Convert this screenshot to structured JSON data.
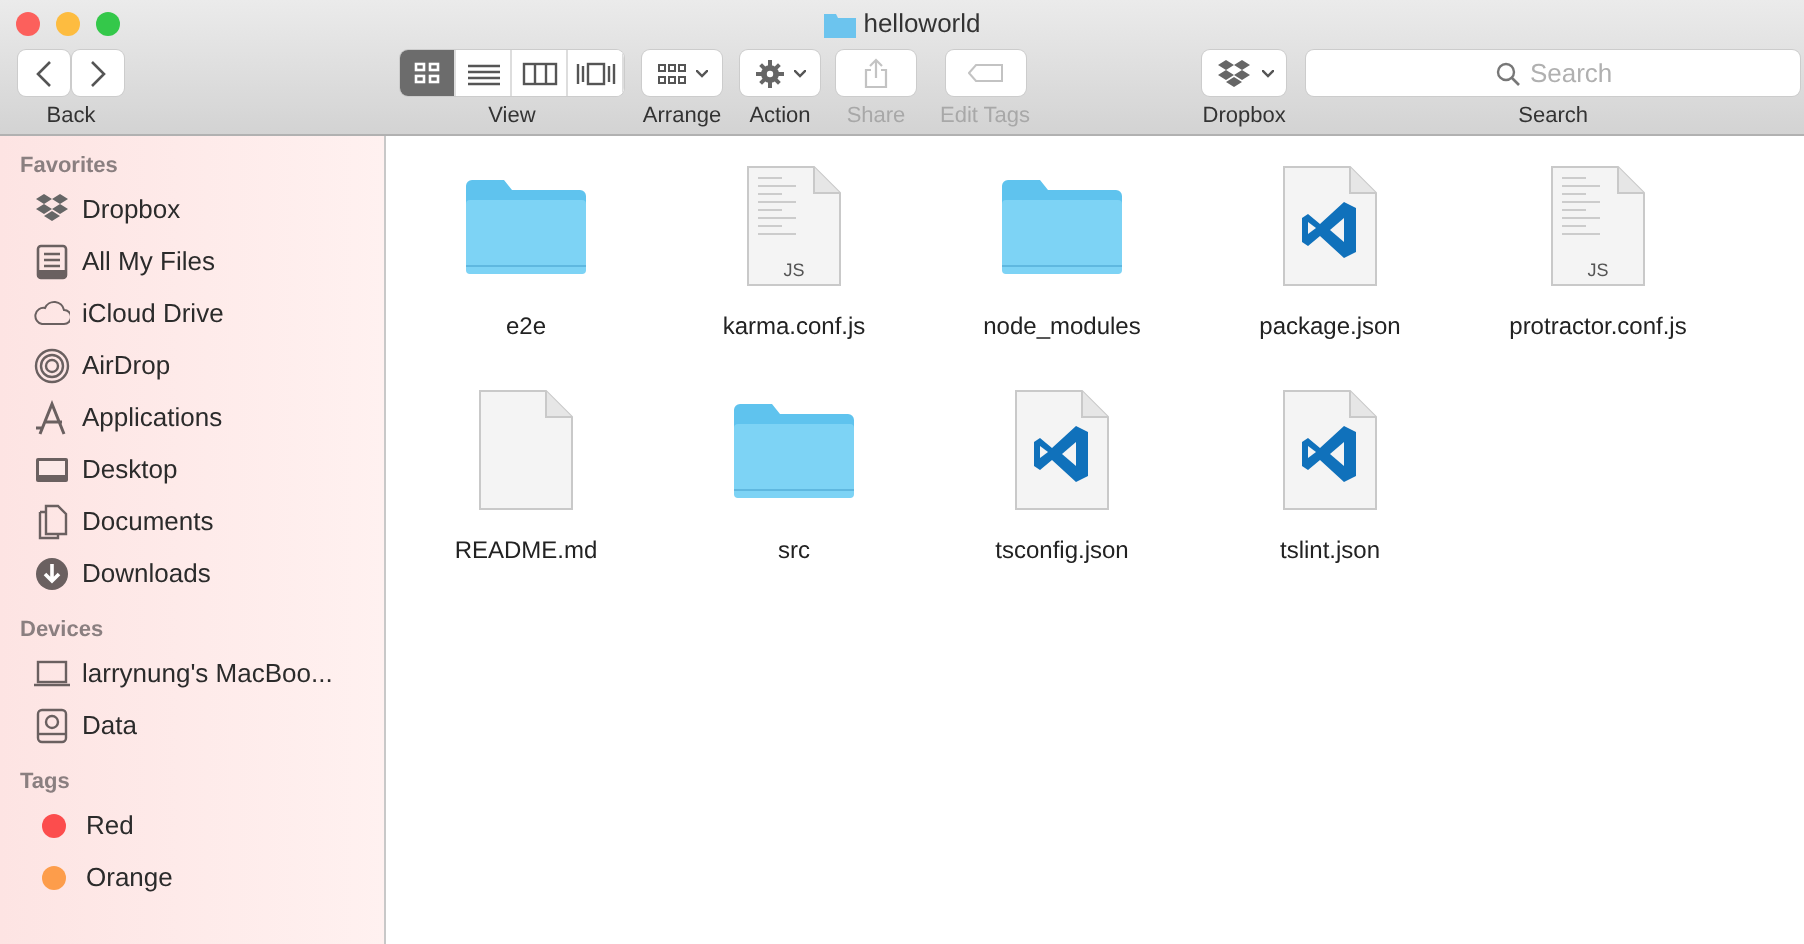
{
  "window": {
    "title": "helloworld"
  },
  "toolbar": [
    {
      "kind": "nav",
      "label": "Back",
      "disabled": false
    },
    {
      "kind": "view",
      "label": "View",
      "disabled": false,
      "modes": [
        {
          "kind": "icons",
          "selected": true
        },
        {
          "kind": "list",
          "selected": false
        },
        {
          "kind": "columns",
          "selected": false
        },
        {
          "kind": "coverflow",
          "selected": false
        }
      ]
    },
    {
      "kind": "arrange",
      "label": "Arrange",
      "disabled": false
    },
    {
      "kind": "action",
      "label": "Action",
      "disabled": false
    },
    {
      "kind": "share",
      "label": "Share",
      "disabled": true
    },
    {
      "kind": "tags",
      "label": "Edit Tags",
      "disabled": true
    },
    {
      "kind": "dropbox",
      "label": "Dropbox",
      "disabled": false
    },
    {
      "kind": "search",
      "label": "Search",
      "disabled": false,
      "placeholder": "Search"
    }
  ],
  "sidebar": [
    {
      "title": "Favorites",
      "items": [
        {
          "label": "Dropbox",
          "kind": "dropbox"
        },
        {
          "label": "All My Files",
          "kind": "allfiles"
        },
        {
          "label": "iCloud Drive",
          "kind": "cloud"
        },
        {
          "label": "AirDrop",
          "kind": "airdrop"
        },
        {
          "label": "Applications",
          "kind": "apps"
        },
        {
          "label": "Desktop",
          "kind": "desktop"
        },
        {
          "label": "Documents",
          "kind": "documents"
        },
        {
          "label": "Downloads",
          "kind": "downloads"
        }
      ]
    },
    {
      "title": "Devices",
      "items": [
        {
          "label": "larrynung's MacBoo...",
          "kind": "laptop"
        },
        {
          "label": "Data",
          "kind": "disk"
        }
      ]
    },
    {
      "title": "Tags",
      "items": [
        {
          "label": "Red",
          "kind": "tag",
          "color": "#fc4d4d"
        },
        {
          "label": "Orange",
          "kind": "tag",
          "color": "#fd9d4b"
        }
      ]
    }
  ],
  "files": [
    {
      "name": "e2e",
      "kind": "folder"
    },
    {
      "name": "karma.conf.js",
      "kind": "js",
      "icon_text": "JS"
    },
    {
      "name": "node_modules",
      "kind": "folder"
    },
    {
      "name": "package.json",
      "kind": "vscode"
    },
    {
      "name": "protractor.conf.js",
      "kind": "js",
      "icon_text": "JS"
    },
    {
      "name": "README.md",
      "kind": "blank"
    },
    {
      "name": "src",
      "kind": "folder"
    },
    {
      "name": "tsconfig.json",
      "kind": "vscode"
    },
    {
      "name": "tslint.json",
      "kind": "vscode"
    }
  ]
}
